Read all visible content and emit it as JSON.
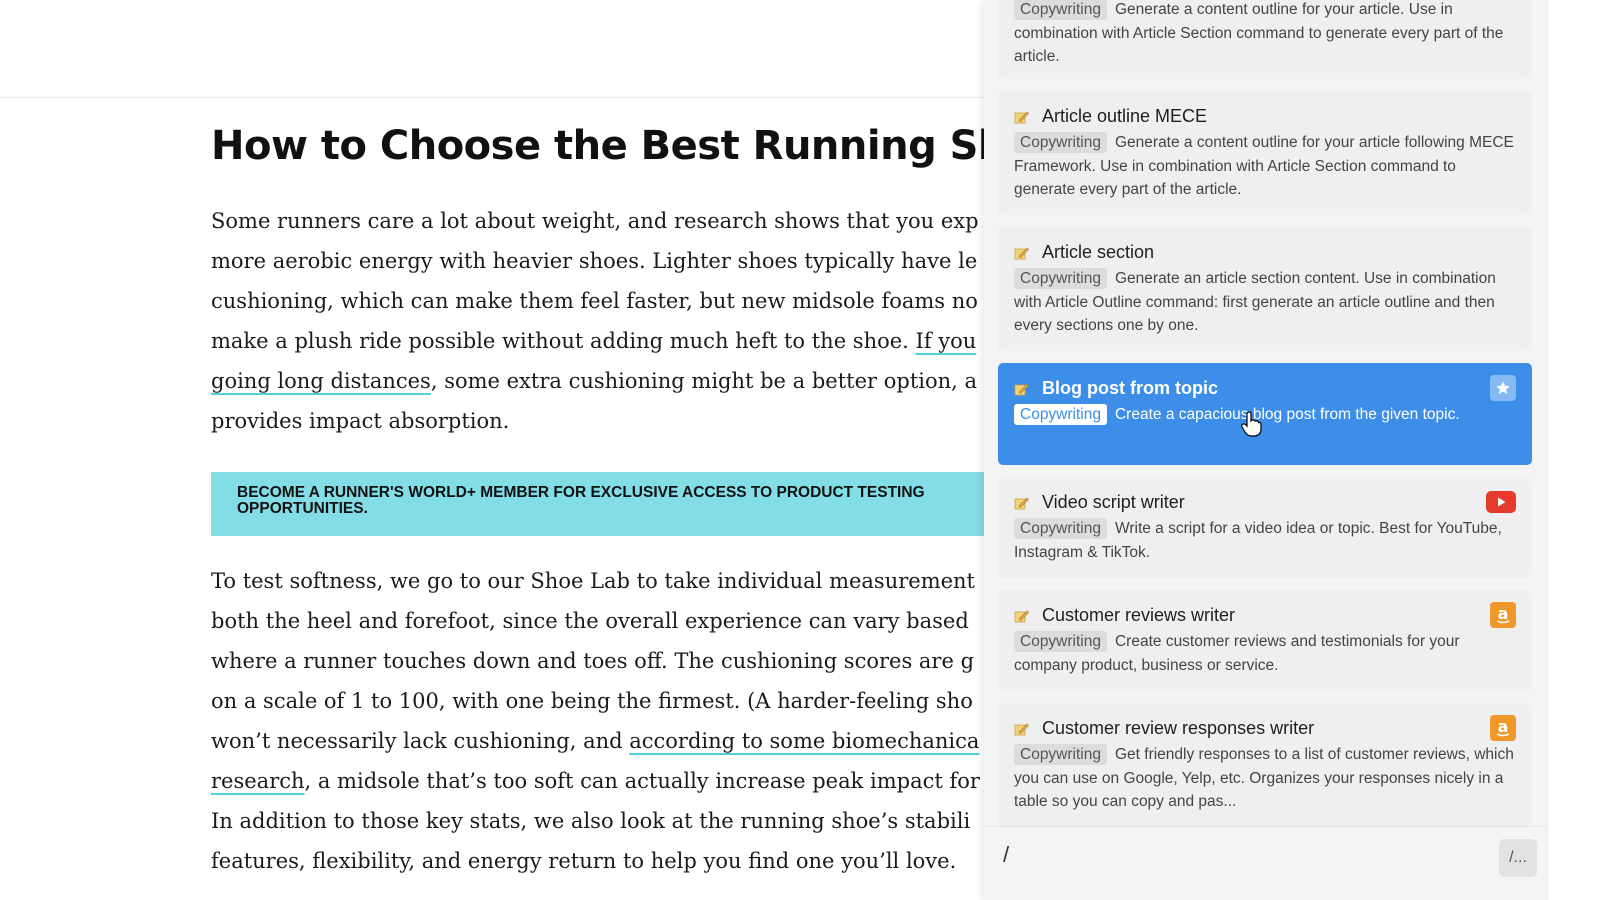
{
  "article": {
    "title": "How to Choose the Best Running Shoe",
    "para1": {
      "l1": "Some runners care a lot about weight, and research shows that you exp",
      "l2": "more aerobic energy with heavier shoes. Lighter shoes typically have le",
      "l3": "cushioning, which can make them feel faster, but new midsole foams no",
      "l4_a": "make a plush ride possible without adding much heft to the shoe. ",
      "l4_link": "If you",
      "l5_link": "going long distances",
      "l5_b": ", some extra cushioning might be a better option, a",
      "l6": "provides impact absorption."
    },
    "banner": "BECOME A RUNNER'S WORLD+ MEMBER FOR EXCLUSIVE ACCESS TO PRODUCT TESTING OPPORTUNITIES.",
    "para2": {
      "l1": "To test softness, we go to our Shoe Lab to take individual measurement",
      "l2": "both the heel and forefoot, since the overall experience can vary based",
      "l3": "where a runner touches down and toes off. The cushioning scores are g",
      "l4": "on a scale of 1 to 100, with one being the firmest. (A harder-feeling sho",
      "l5_a": "won’t necessarily lack cushioning, and ",
      "l5_link": "according to some biomechanica",
      "l6_link": "research",
      "l6_b": ", a midsole that’s too soft can actually increase peak impact for",
      "l7": "In addition to those key stats, we also look at the running shoe’s stabili",
      "l8": "features, flexibility, and energy return to help you find one you’ll love."
    }
  },
  "panel": {
    "cards": [
      {
        "title": "",
        "tag": "Copywriting",
        "desc": "Generate a content outline for your article. Use in combination with Article Section command to generate every part of the article."
      },
      {
        "title": "Article outline MECE",
        "tag": "Copywriting",
        "desc": "Generate a content outline for your article following MECE Framework. Use in combination with Article Section command to generate every part of the article."
      },
      {
        "title": "Article section",
        "tag": "Copywriting",
        "desc": "Generate an article section content. Use in combination with Article Outline command: first generate an article outline and then every sections one by one."
      },
      {
        "title": "Blog post from topic",
        "tag": "Copywriting",
        "desc": "Create a capacious blog post from the given topic.",
        "badge": "star-icon",
        "active": true
      },
      {
        "title": "Video script writer",
        "tag": "Copywriting",
        "desc": "Write a script for a video idea or topic. Best for YouTube, Instagram & TikTok.",
        "badge": "youtube-icon"
      },
      {
        "title": "Customer reviews writer",
        "tag": "Copywriting",
        "desc": "Create customer reviews and testimonials for your company product, business or service.",
        "badge": "amazon-icon"
      },
      {
        "title": "Customer review responses writer",
        "tag": "Copywriting",
        "desc": "Get friendly responses to a list of customer reviews, which you can use on Google, Yelp, etc. Organizes your responses nicely in a table so you can copy and pas...",
        "badge": "amazon-icon"
      }
    ],
    "input_value": "/",
    "command_button": "/..."
  },
  "colors": {
    "accent": "#3d8ee8",
    "banner": "#83dde6",
    "link_underline": "#4fd1d9",
    "youtube": "#e43b2c",
    "amazon": "#f0972a"
  }
}
